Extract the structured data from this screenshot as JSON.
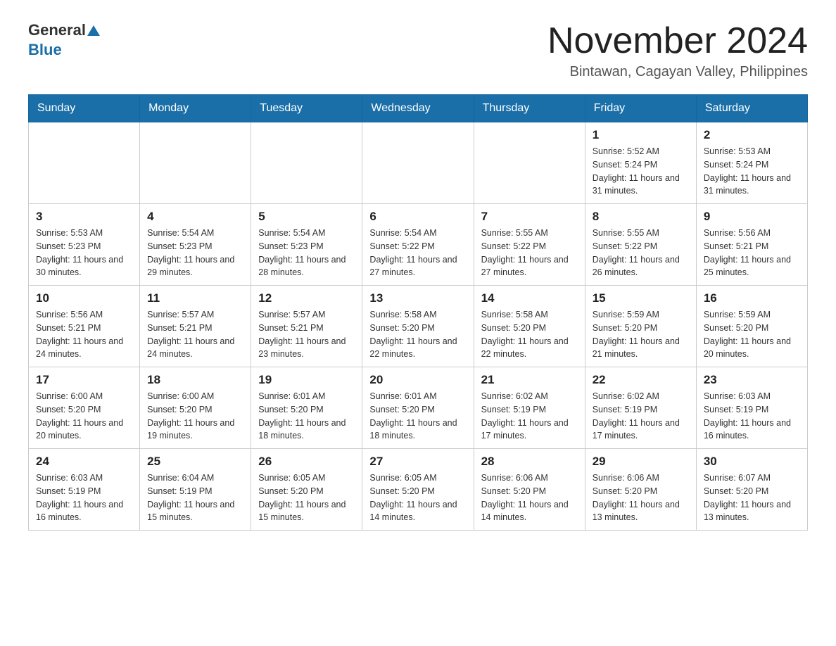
{
  "header": {
    "logo_general": "General",
    "logo_blue": "Blue",
    "month_title": "November 2024",
    "location": "Bintawan, Cagayan Valley, Philippines"
  },
  "days_of_week": [
    "Sunday",
    "Monday",
    "Tuesday",
    "Wednesday",
    "Thursday",
    "Friday",
    "Saturday"
  ],
  "weeks": [
    [
      {
        "day": "",
        "info": ""
      },
      {
        "day": "",
        "info": ""
      },
      {
        "day": "",
        "info": ""
      },
      {
        "day": "",
        "info": ""
      },
      {
        "day": "",
        "info": ""
      },
      {
        "day": "1",
        "info": "Sunrise: 5:52 AM\nSunset: 5:24 PM\nDaylight: 11 hours and 31 minutes."
      },
      {
        "day": "2",
        "info": "Sunrise: 5:53 AM\nSunset: 5:24 PM\nDaylight: 11 hours and 31 minutes."
      }
    ],
    [
      {
        "day": "3",
        "info": "Sunrise: 5:53 AM\nSunset: 5:23 PM\nDaylight: 11 hours and 30 minutes."
      },
      {
        "day": "4",
        "info": "Sunrise: 5:54 AM\nSunset: 5:23 PM\nDaylight: 11 hours and 29 minutes."
      },
      {
        "day": "5",
        "info": "Sunrise: 5:54 AM\nSunset: 5:23 PM\nDaylight: 11 hours and 28 minutes."
      },
      {
        "day": "6",
        "info": "Sunrise: 5:54 AM\nSunset: 5:22 PM\nDaylight: 11 hours and 27 minutes."
      },
      {
        "day": "7",
        "info": "Sunrise: 5:55 AM\nSunset: 5:22 PM\nDaylight: 11 hours and 27 minutes."
      },
      {
        "day": "8",
        "info": "Sunrise: 5:55 AM\nSunset: 5:22 PM\nDaylight: 11 hours and 26 minutes."
      },
      {
        "day": "9",
        "info": "Sunrise: 5:56 AM\nSunset: 5:21 PM\nDaylight: 11 hours and 25 minutes."
      }
    ],
    [
      {
        "day": "10",
        "info": "Sunrise: 5:56 AM\nSunset: 5:21 PM\nDaylight: 11 hours and 24 minutes."
      },
      {
        "day": "11",
        "info": "Sunrise: 5:57 AM\nSunset: 5:21 PM\nDaylight: 11 hours and 24 minutes."
      },
      {
        "day": "12",
        "info": "Sunrise: 5:57 AM\nSunset: 5:21 PM\nDaylight: 11 hours and 23 minutes."
      },
      {
        "day": "13",
        "info": "Sunrise: 5:58 AM\nSunset: 5:20 PM\nDaylight: 11 hours and 22 minutes."
      },
      {
        "day": "14",
        "info": "Sunrise: 5:58 AM\nSunset: 5:20 PM\nDaylight: 11 hours and 22 minutes."
      },
      {
        "day": "15",
        "info": "Sunrise: 5:59 AM\nSunset: 5:20 PM\nDaylight: 11 hours and 21 minutes."
      },
      {
        "day": "16",
        "info": "Sunrise: 5:59 AM\nSunset: 5:20 PM\nDaylight: 11 hours and 20 minutes."
      }
    ],
    [
      {
        "day": "17",
        "info": "Sunrise: 6:00 AM\nSunset: 5:20 PM\nDaylight: 11 hours and 20 minutes."
      },
      {
        "day": "18",
        "info": "Sunrise: 6:00 AM\nSunset: 5:20 PM\nDaylight: 11 hours and 19 minutes."
      },
      {
        "day": "19",
        "info": "Sunrise: 6:01 AM\nSunset: 5:20 PM\nDaylight: 11 hours and 18 minutes."
      },
      {
        "day": "20",
        "info": "Sunrise: 6:01 AM\nSunset: 5:20 PM\nDaylight: 11 hours and 18 minutes."
      },
      {
        "day": "21",
        "info": "Sunrise: 6:02 AM\nSunset: 5:19 PM\nDaylight: 11 hours and 17 minutes."
      },
      {
        "day": "22",
        "info": "Sunrise: 6:02 AM\nSunset: 5:19 PM\nDaylight: 11 hours and 17 minutes."
      },
      {
        "day": "23",
        "info": "Sunrise: 6:03 AM\nSunset: 5:19 PM\nDaylight: 11 hours and 16 minutes."
      }
    ],
    [
      {
        "day": "24",
        "info": "Sunrise: 6:03 AM\nSunset: 5:19 PM\nDaylight: 11 hours and 16 minutes."
      },
      {
        "day": "25",
        "info": "Sunrise: 6:04 AM\nSunset: 5:19 PM\nDaylight: 11 hours and 15 minutes."
      },
      {
        "day": "26",
        "info": "Sunrise: 6:05 AM\nSunset: 5:20 PM\nDaylight: 11 hours and 15 minutes."
      },
      {
        "day": "27",
        "info": "Sunrise: 6:05 AM\nSunset: 5:20 PM\nDaylight: 11 hours and 14 minutes."
      },
      {
        "day": "28",
        "info": "Sunrise: 6:06 AM\nSunset: 5:20 PM\nDaylight: 11 hours and 14 minutes."
      },
      {
        "day": "29",
        "info": "Sunrise: 6:06 AM\nSunset: 5:20 PM\nDaylight: 11 hours and 13 minutes."
      },
      {
        "day": "30",
        "info": "Sunrise: 6:07 AM\nSunset: 5:20 PM\nDaylight: 11 hours and 13 minutes."
      }
    ]
  ]
}
